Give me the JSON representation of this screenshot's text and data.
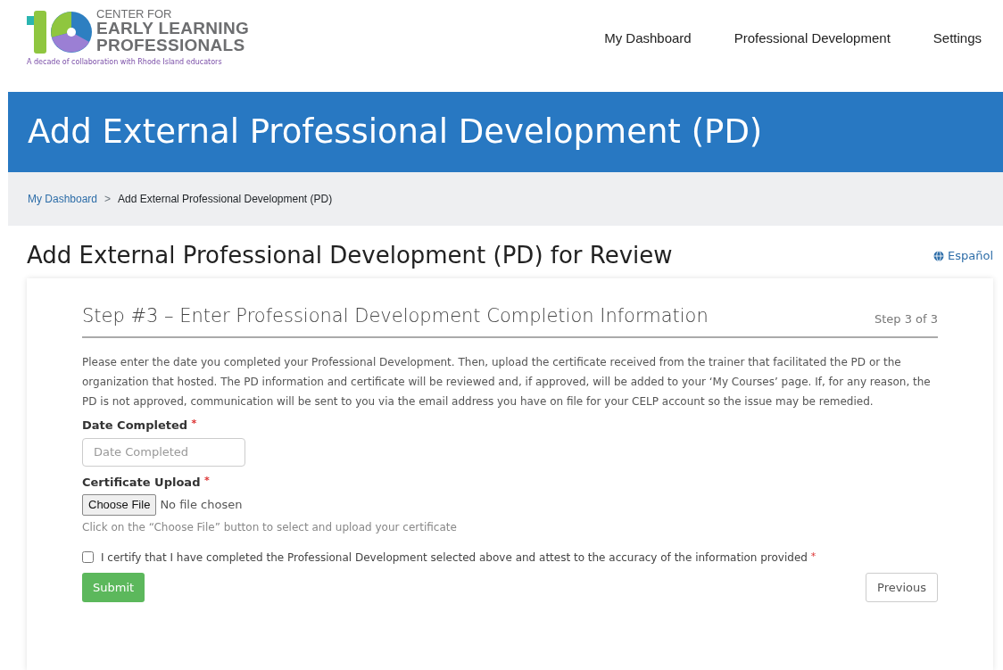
{
  "logo": {
    "lines": [
      "CENTER FOR",
      "EARLY LEARNING",
      "PROFESSIONALS"
    ],
    "tagline": "A decade of collaboration with Rhode Island educators"
  },
  "nav": [
    "My Dashboard",
    "Professional Development",
    "Settings"
  ],
  "banner": {
    "title": "Add External Professional Development (PD)"
  },
  "breadcrumb": [
    {
      "label": "My Dashboard",
      "link": true
    },
    {
      "label": "Add External Professional Development (PD)",
      "link": false
    }
  ],
  "breadcrumb_separator": ">",
  "page_title": "Add External Professional Development (PD) for Review",
  "language_link": "Español",
  "step": {
    "title": "Step #3 – Enter Professional Development Completion Information",
    "counter": "Step 3 of 3"
  },
  "instructions": "Please enter the date you completed your Professional Development. Then, upload the certificate received from the trainer that facilitated the PD or the organization that hosted. The PD information and certificate will be reviewed and, if approved, will be added to your ‘My Courses’ page. If, for any reason, the PD is not approved, communication will be sent to you via the email address you have on file for your CELP account so the issue may be remedied.",
  "fields": [
    {
      "kind": "date",
      "label": "Date Completed",
      "required_mark": "*",
      "placeholder": "Date Completed"
    },
    {
      "kind": "file",
      "label": "Certificate Upload",
      "required_mark": "*",
      "button": "Choose File",
      "status": "No file chosen",
      "help": "Click on the “Choose File” button to select and upload your certificate"
    }
  ],
  "certify": {
    "label": "I certify that I have completed the Professional Development selected above and attest to the accuracy of the information provided",
    "required_mark": "*",
    "checked": false
  },
  "buttons": {
    "submit": "Submit",
    "previous": "Previous"
  }
}
